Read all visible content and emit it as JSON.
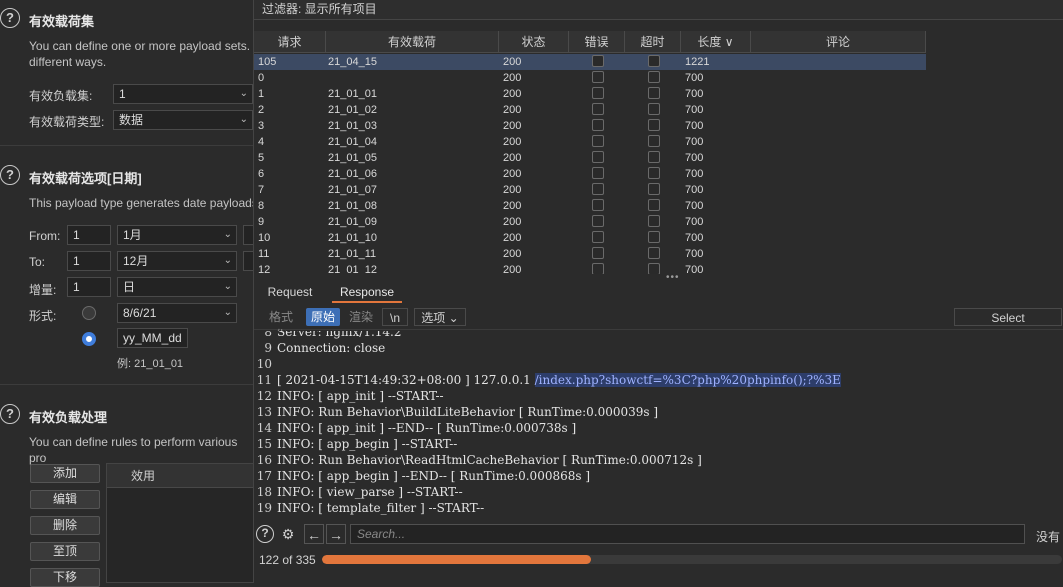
{
  "left_panel": {
    "sets": {
      "title": "有效载荷集",
      "desc_line1": "You can define one or more payload sets. T",
      "desc_line2": "different ways.",
      "set_label": "有效负载集:",
      "set_value": "1",
      "type_label": "有效载荷类型:",
      "type_value": "数据"
    },
    "options": {
      "title": "有效载荷选项[日期]",
      "desc": "This payload type generates date payloads",
      "from_label": "From:",
      "from_day": "1",
      "from_month": "1月",
      "to_label": "To:",
      "to_day": "1",
      "to_month": "12月",
      "step_label": "增量:",
      "step_value": "1",
      "step_unit": "日",
      "format_label": "形式:",
      "format_preset": "8/6/21",
      "format_custom": "yy_MM_dd",
      "example": "例: 21_01_01"
    },
    "processing": {
      "title": "有效负载处理",
      "desc": "You can define rules to perform various pro",
      "buttons": [
        "添加",
        "编辑",
        "删除",
        "至顶",
        "下移"
      ],
      "column": "效用"
    }
  },
  "results": {
    "filter": "过滤器:   显示所有项目",
    "columns": [
      "请求",
      "有效载荷",
      "状态",
      "错误",
      "超时",
      "长度",
      "评论"
    ],
    "sort_indicator": "∨",
    "rows": [
      {
        "req": "105",
        "payload": "21_04_15",
        "status": "200",
        "len": "1221"
      },
      {
        "req": "0",
        "payload": "",
        "status": "200",
        "len": "700"
      },
      {
        "req": "1",
        "payload": "21_01_01",
        "status": "200",
        "len": "700"
      },
      {
        "req": "2",
        "payload": "21_01_02",
        "status": "200",
        "len": "700"
      },
      {
        "req": "3",
        "payload": "21_01_03",
        "status": "200",
        "len": "700"
      },
      {
        "req": "4",
        "payload": "21_01_04",
        "status": "200",
        "len": "700"
      },
      {
        "req": "5",
        "payload": "21_01_05",
        "status": "200",
        "len": "700"
      },
      {
        "req": "6",
        "payload": "21_01_06",
        "status": "200",
        "len": "700"
      },
      {
        "req": "7",
        "payload": "21_01_07",
        "status": "200",
        "len": "700"
      },
      {
        "req": "8",
        "payload": "21_01_08",
        "status": "200",
        "len": "700"
      },
      {
        "req": "9",
        "payload": "21_01_09",
        "status": "200",
        "len": "700"
      },
      {
        "req": "10",
        "payload": "21_01_10",
        "status": "200",
        "len": "700"
      },
      {
        "req": "11",
        "payload": "21_01_11",
        "status": "200",
        "len": "700"
      },
      {
        "req": "12",
        "payload": "21_01_12",
        "status": "200",
        "len": "700"
      }
    ]
  },
  "viewer": {
    "tabs": [
      "Request",
      "Response"
    ],
    "view_modes": [
      "格式化",
      "原始",
      "渲染",
      "\\n",
      "选项"
    ],
    "select_extension": "Select extension...",
    "lines": [
      {
        "n": "8",
        "text": "Server: nginx/1.14.2"
      },
      {
        "n": "9",
        "text": "Connection: close"
      },
      {
        "n": "10",
        "text": ""
      },
      {
        "n": "11",
        "text": "[ 2021-04-15T14:49:32+08:00 ] 127.0.0.1 ",
        "hl": "/index.php?showctf=%3C?php%20phpinfo();?%3E"
      },
      {
        "n": "12",
        "text": "INFO: [ app_init ] --START--"
      },
      {
        "n": "13",
        "text": "INFO: Run Behavior\\BuildLiteBehavior [ RunTime:0.000039s ]"
      },
      {
        "n": "14",
        "text": "INFO: [ app_init ] --END-- [ RunTime:0.000738s ]"
      },
      {
        "n": "15",
        "text": "INFO: [ app_begin ] --START--"
      },
      {
        "n": "16",
        "text": "INFO: Run Behavior\\ReadHtmlCacheBehavior [ RunTime:0.000712s ]"
      },
      {
        "n": "17",
        "text": "INFO: [ app_begin ] --END-- [ RunTime:0.000868s ]"
      },
      {
        "n": "18",
        "text": "INFO: [ view_parse ] --START--"
      },
      {
        "n": "19",
        "text": "INFO: [ template_filter ] --START--"
      }
    ],
    "search_placeholder": "Search...",
    "search_result": "没有匹",
    "progress_label": "122 of 335",
    "progress_fraction": 0.364,
    "accent": "#e2763c",
    "selection": "#3d6fb6"
  }
}
